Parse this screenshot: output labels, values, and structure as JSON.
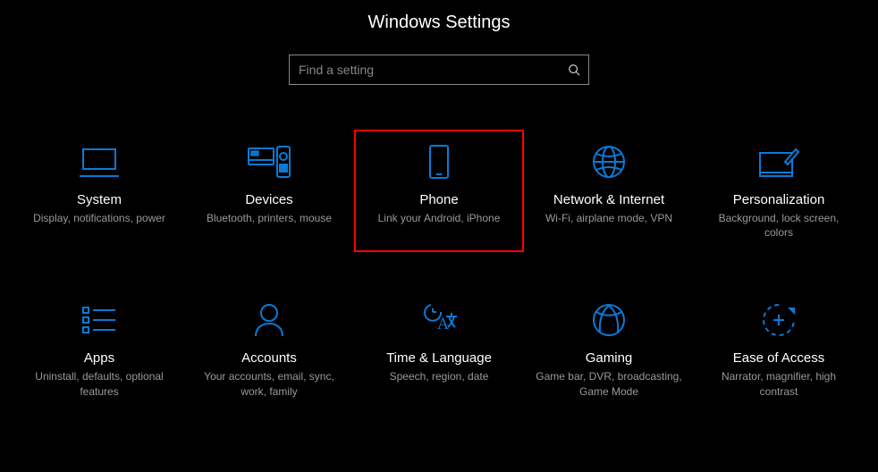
{
  "title": "Windows Settings",
  "search": {
    "placeholder": "Find a setting"
  },
  "tiles": [
    {
      "label": "System",
      "sub": "Display, notifications, power"
    },
    {
      "label": "Devices",
      "sub": "Bluetooth, printers, mouse"
    },
    {
      "label": "Phone",
      "sub": "Link your Android, iPhone",
      "highlight": true
    },
    {
      "label": "Network & Internet",
      "sub": "Wi-Fi, airplane mode, VPN"
    },
    {
      "label": "Personalization",
      "sub": "Background, lock screen, colors"
    },
    {
      "label": "Apps",
      "sub": "Uninstall, defaults, optional features"
    },
    {
      "label": "Accounts",
      "sub": "Your accounts, email, sync, work, family"
    },
    {
      "label": "Time & Language",
      "sub": "Speech, region, date"
    },
    {
      "label": "Gaming",
      "sub": "Game bar, DVR, broadcasting, Game Mode"
    },
    {
      "label": "Ease of Access",
      "sub": "Narrator, magnifier, high contrast"
    }
  ],
  "colors": {
    "accent": "#0a7ad6"
  }
}
